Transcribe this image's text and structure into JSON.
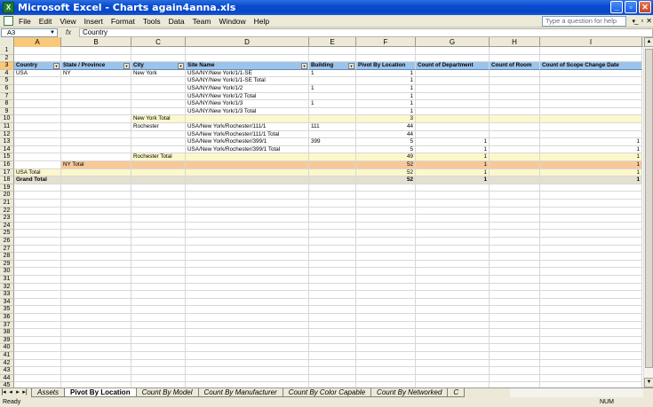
{
  "window": {
    "title": "Microsoft Excel - Charts again4anna.xls",
    "app_icon": "excel-icon"
  },
  "menu": {
    "items": [
      "File",
      "Edit",
      "View",
      "Insert",
      "Format",
      "Tools",
      "Data",
      "Team",
      "Window",
      "Help"
    ],
    "help_placeholder": "Type a question for help"
  },
  "formula_bar": {
    "name_box": "A3",
    "fx": "fx",
    "content": "Country"
  },
  "columns": [
    {
      "label": "A",
      "selected": true
    },
    {
      "label": "B"
    },
    {
      "label": "C"
    },
    {
      "label": "D"
    },
    {
      "label": "E"
    },
    {
      "label": "F"
    },
    {
      "label": "G"
    },
    {
      "label": "H"
    },
    {
      "label": "I"
    }
  ],
  "header_row": [
    "Country",
    "State / Province",
    "City",
    "Site Name",
    "Building",
    "Pivot By Location",
    "Count of Department",
    "Count of Room",
    "Count of Scope Change Date"
  ],
  "data_rows": [
    {
      "row": "4",
      "cells": [
        "USA",
        "NY",
        "New York",
        "USA/NY/New York/1/1-SE",
        "1",
        "1",
        "",
        "",
        ""
      ]
    },
    {
      "row": "5",
      "cells": [
        "",
        "",
        "",
        "USA/NY/New York/1/1-SE Total",
        "",
        "1",
        "",
        "",
        ""
      ]
    },
    {
      "row": "6",
      "cells": [
        "",
        "",
        "",
        "USA/NY/New York/1/2",
        "1",
        "1",
        "",
        "",
        ""
      ]
    },
    {
      "row": "7",
      "cells": [
        "",
        "",
        "",
        "USA/NY/New York/1/2 Total",
        "",
        "1",
        "",
        "",
        ""
      ]
    },
    {
      "row": "8",
      "cells": [
        "",
        "",
        "",
        "USA/NY/New York/1/3",
        "1",
        "1",
        "",
        "",
        ""
      ]
    },
    {
      "row": "9",
      "cells": [
        "",
        "",
        "",
        "USA/NY/New York/1/3 Total",
        "",
        "1",
        "",
        "",
        ""
      ]
    },
    {
      "row": "10",
      "band": "city",
      "cells": [
        "",
        "",
        "New York Total",
        "",
        "",
        "3",
        "",
        "",
        ""
      ]
    },
    {
      "row": "11",
      "cells": [
        "",
        "",
        "Rochester",
        "USA/New York/Rochester/111/1",
        "111",
        "44",
        "",
        "",
        ""
      ]
    },
    {
      "row": "12",
      "cells": [
        "",
        "",
        "",
        "USA/New York/Rochester/111/1 Total",
        "",
        "44",
        "",
        "",
        ""
      ]
    },
    {
      "row": "13",
      "cells": [
        "",
        "",
        "",
        "USA/New York/Rochester/399/1",
        "399",
        "5",
        "1",
        "",
        "1"
      ]
    },
    {
      "row": "14",
      "cells": [
        "",
        "",
        "",
        "USA/New York/Rochester/399/1 Total",
        "",
        "5",
        "1",
        "",
        "1"
      ]
    },
    {
      "row": "15",
      "band": "city",
      "cells": [
        "",
        "",
        "Rochester Total",
        "",
        "",
        "49",
        "1",
        "",
        "1"
      ]
    },
    {
      "row": "16",
      "band": "state",
      "cells": [
        "",
        "NY Total",
        "",
        "",
        "",
        "52",
        "1",
        "",
        "1"
      ]
    },
    {
      "row": "17",
      "band": "country",
      "cells": [
        "USA Total",
        "",
        "",
        "",
        "",
        "52",
        "1",
        "",
        "1"
      ]
    },
    {
      "row": "18",
      "band": "grand",
      "cells": [
        "Grand Total",
        "",
        "",
        "",
        "",
        "52",
        "1",
        "",
        "1"
      ]
    }
  ],
  "empty_rows_start": 19,
  "empty_rows_end": 47,
  "sheet_tabs": [
    {
      "label": "Assets"
    },
    {
      "label": "Pivot By Location",
      "active": true
    },
    {
      "label": "Count By Model"
    },
    {
      "label": "Count By Manufacturer"
    },
    {
      "label": "Count By Color Capable"
    },
    {
      "label": "Count By Networked"
    },
    {
      "label": "C"
    }
  ],
  "status": {
    "left": "Ready",
    "num": "NUM"
  },
  "colors": {
    "header_fill": "#9cc3ec",
    "city_total": "#fcf8cc",
    "state_total": "#f8c898",
    "grand_total": "#e4e0d0",
    "selected_heading": "#f9c878"
  }
}
